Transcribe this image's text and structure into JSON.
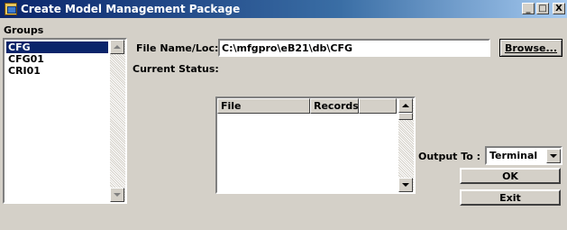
{
  "window": {
    "title": "Create Model Management Package",
    "controls": {
      "minimize": "_",
      "maximize": "□",
      "close": "X"
    }
  },
  "groups": {
    "label": "Groups",
    "items": [
      "CFG",
      "CFG01",
      "CRI01"
    ],
    "selected_index": 0
  },
  "file_name": {
    "label": "File Name/Loc:",
    "value": "C:\\mfgpro\\eB21\\db\\CFG",
    "browse_label": "Browse..."
  },
  "status": {
    "label": "Current Status:"
  },
  "table": {
    "columns": [
      "File",
      "Records"
    ],
    "rows": []
  },
  "output": {
    "label": "Output To  :",
    "selected": "Terminal"
  },
  "buttons": {
    "ok": "OK",
    "exit": "Exit"
  }
}
